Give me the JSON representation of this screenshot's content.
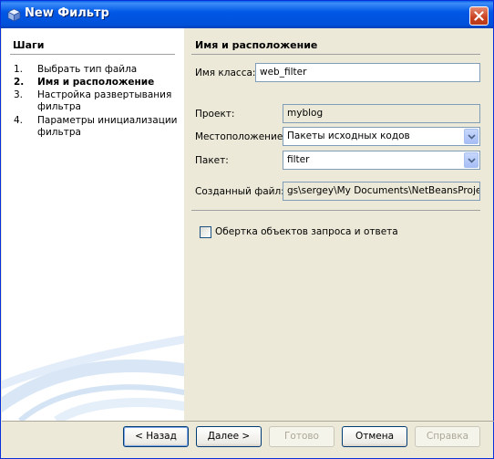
{
  "window": {
    "title": "New Фильтр",
    "icon": "cube-icon",
    "close_icon": "close-icon"
  },
  "steps": {
    "title": "Шаги",
    "items": [
      {
        "num": "1.",
        "label": "Выбрать тип файла",
        "active": false
      },
      {
        "num": "2.",
        "label": "Имя и расположение",
        "active": true
      },
      {
        "num": "3.",
        "label": "Настройка развертывания фильтра",
        "active": false
      },
      {
        "num": "4.",
        "label": "Параметры инициализации фильтра",
        "active": false
      }
    ]
  },
  "panel": {
    "title": "Имя и расположение",
    "class_name_label": "Имя класса:",
    "class_name_value": "web_filter",
    "project_label": "Проект:",
    "project_value": "myblog",
    "location_label": "Местоположение:",
    "location_value": "Пакеты исходных кодов",
    "package_label": "Пакет:",
    "package_value": "filter",
    "created_file_label": "Созданный файл:",
    "created_file_value": "gs\\sergey\\My Documents\\NetBeansProjects",
    "wrapper_checkbox_label": "Обертка объектов запроса и ответа",
    "wrapper_checked": false
  },
  "buttons": {
    "back": "< Назад",
    "next": "Далее >",
    "finish": "Готово",
    "cancel": "Отмена",
    "help": "Справка"
  },
  "colors": {
    "titlebar": "#0054e3",
    "dialog_bg": "#ece9d8",
    "field_border": "#7f9db9"
  }
}
